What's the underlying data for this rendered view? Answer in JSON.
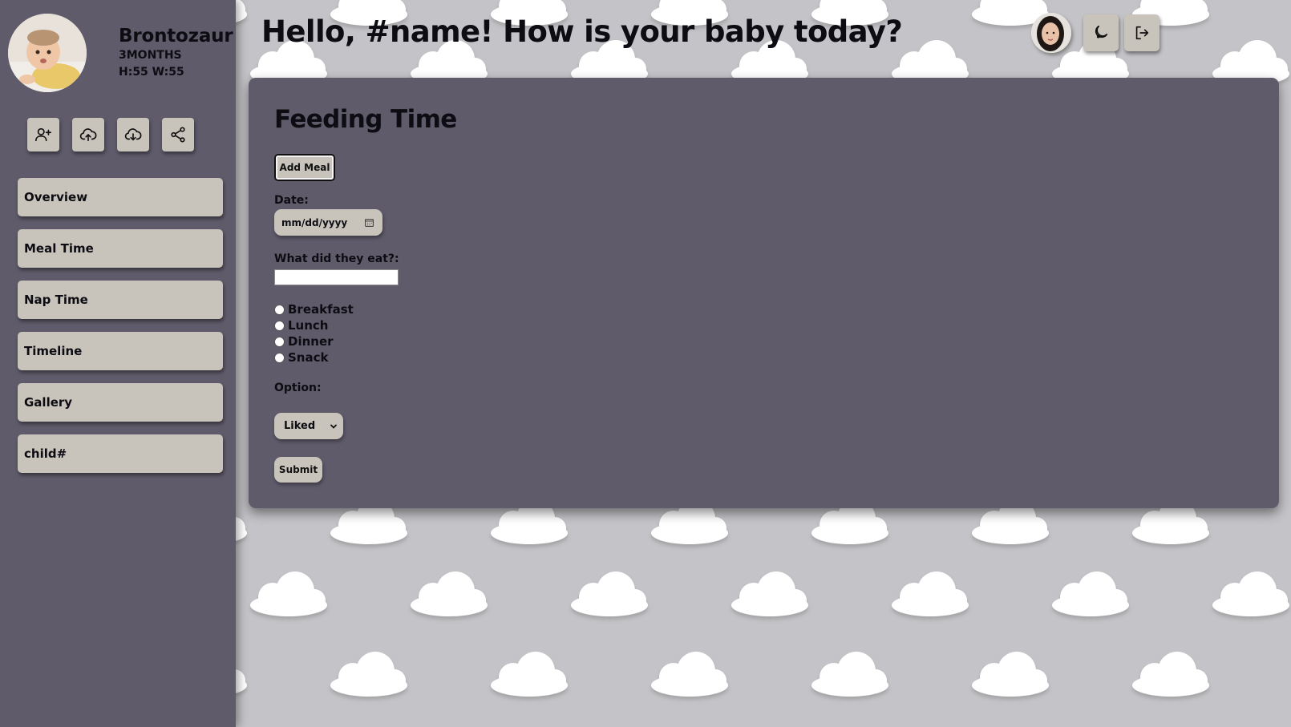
{
  "colors": {
    "sidebar_bg": "#5f5b6b",
    "panel_bg": "#5f5b6b",
    "button_bg": "#c9c4bb",
    "page_bg": "#c4c4c8",
    "cloud": "#ffffff",
    "text": "#0c0c12"
  },
  "sidebar": {
    "baby_name": "Brontozaur",
    "age": "3MONTHS",
    "measurements": "H:55 W:55",
    "icon_buttons": [
      {
        "icon": "add-user-icon"
      },
      {
        "icon": "cloud-upload-icon"
      },
      {
        "icon": "cloud-download-icon"
      },
      {
        "icon": "share-icon"
      }
    ],
    "nav_items": [
      {
        "label": "Overview"
      },
      {
        "label": "Meal Time"
      },
      {
        "label": "Nap Time"
      },
      {
        "label": "Timeline"
      },
      {
        "label": "Gallery"
      }
    ],
    "child_item": {
      "label": "child#"
    }
  },
  "header": {
    "greeting": "Hello, #name! How is your baby today?",
    "buttons": [
      {
        "icon": "moon-icon"
      },
      {
        "icon": "logout-icon"
      }
    ]
  },
  "form": {
    "title": "Feeding Time",
    "add_meal_label": "Add Meal",
    "date_label": "Date:",
    "date_placeholder": "mm/dd/yyyy",
    "eat_label": "What did they eat?:",
    "eat_value": "",
    "meal_options": [
      {
        "label": "Breakfast"
      },
      {
        "label": "Lunch"
      },
      {
        "label": "Dinner"
      },
      {
        "label": "Snack"
      }
    ],
    "option_label": "Option:",
    "option_selected": "Liked",
    "submit_label": "Submit"
  }
}
